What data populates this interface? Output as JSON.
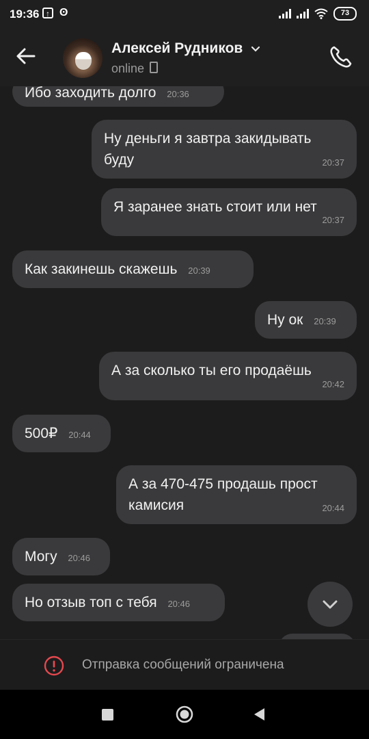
{
  "status_bar": {
    "time": "19:36",
    "battery": "73"
  },
  "header": {
    "contact_name": "Алексей Рудников",
    "status": "online"
  },
  "messages": [
    {
      "text": "Ибо заходить долго",
      "time": "20:36",
      "side": "in"
    },
    {
      "text": "Ну деньги я завтра закидывать буду",
      "time": "20:37",
      "side": "out"
    },
    {
      "text": "Я заранее знать стоит или нет",
      "time": "20:37",
      "side": "out"
    },
    {
      "text": "Как закинешь скажешь",
      "time": "20:39",
      "side": "in"
    },
    {
      "text": "Ну ок",
      "time": "20:39",
      "side": "out"
    },
    {
      "text": "А за сколько ты его продаёшь",
      "time": "20:42",
      "side": "out"
    },
    {
      "text": "500₽",
      "time": "20:44",
      "side": "in"
    },
    {
      "text": "А за 470-475 продашь прост камисия",
      "time": "20:44",
      "side": "out"
    },
    {
      "text": "Могу",
      "time": "20:46",
      "side": "in"
    },
    {
      "text": "Но отзыв топ с тебя",
      "time": "20:46",
      "side": "in"
    }
  ],
  "footer": {
    "restriction_text": "Отправка сообщений ограничена"
  },
  "icons": [
    "back-arrow-icon",
    "phone-call-icon",
    "chevron-down-icon",
    "warning-icon",
    "mobile-device-icon"
  ]
}
